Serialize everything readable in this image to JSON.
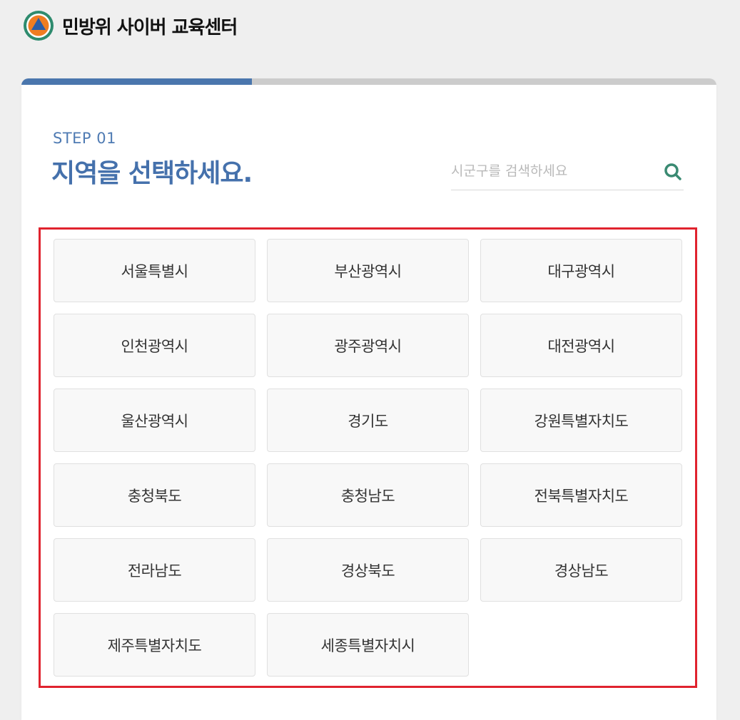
{
  "site": {
    "title": "민방위 사이버 교육센터",
    "logo_icon": "civil-defense-logo-icon"
  },
  "progress": {
    "current_step": 1,
    "fraction": 0.332,
    "fill_color": "#4a76ad",
    "track_color": "#cccccc"
  },
  "step": {
    "label": "STEP 01",
    "title": "지역을 선택하세요."
  },
  "search": {
    "placeholder": "시군구를 검색하세요",
    "value": "",
    "icon": "search-icon",
    "icon_color": "#3a8a72"
  },
  "regions": [
    {
      "label": "서울특별시"
    },
    {
      "label": "부산광역시"
    },
    {
      "label": "대구광역시"
    },
    {
      "label": "인천광역시"
    },
    {
      "label": "광주광역시"
    },
    {
      "label": "대전광역시"
    },
    {
      "label": "울산광역시"
    },
    {
      "label": "경기도"
    },
    {
      "label": "강원특별자치도"
    },
    {
      "label": "충청북도"
    },
    {
      "label": "충청남도"
    },
    {
      "label": "전북특별자치도"
    },
    {
      "label": "전라남도"
    },
    {
      "label": "경상북도"
    },
    {
      "label": "경상남도"
    },
    {
      "label": "제주특별자치도"
    },
    {
      "label": "세종특별자치시"
    }
  ],
  "colors": {
    "accent": "#4571ac",
    "highlight_border": "#e0232e",
    "logo_teal": "#2e8b6e",
    "logo_orange": "#ef7d22",
    "logo_blue": "#2a5da8"
  }
}
